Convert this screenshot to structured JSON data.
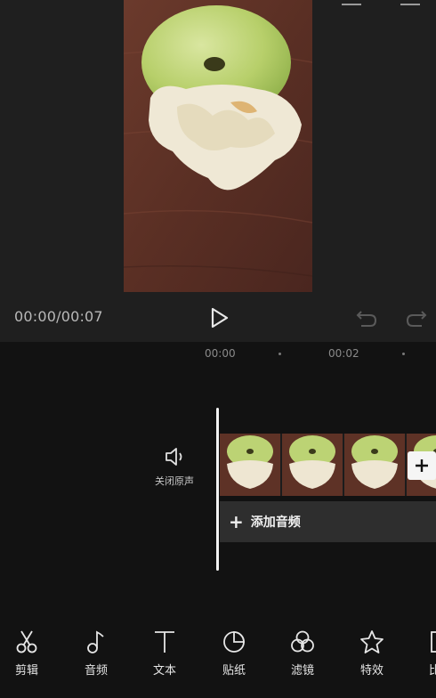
{
  "player": {
    "time_readout": "00:00/00:07"
  },
  "ruler": {
    "labels": [
      "00:00",
      "00:02"
    ]
  },
  "timeline": {
    "mute_label": "关闭原声",
    "add_audio_label": "添加音频"
  },
  "toolbar": {
    "items": [
      {
        "label": "剪辑",
        "icon": "scissors-icon"
      },
      {
        "label": "音频",
        "icon": "music-note-icon"
      },
      {
        "label": "文本",
        "icon": "text-icon"
      },
      {
        "label": "贴纸",
        "icon": "sticker-icon"
      },
      {
        "label": "滤镜",
        "icon": "filter-icon"
      },
      {
        "label": "特效",
        "icon": "effects-star-icon"
      },
      {
        "label": "比",
        "icon": "ratio-icon"
      }
    ]
  },
  "colors": {
    "background": "#121212",
    "preview_background": "#1f1f1f",
    "audio_track": "#2e2e2e",
    "playhead": "#f2f2f2"
  }
}
